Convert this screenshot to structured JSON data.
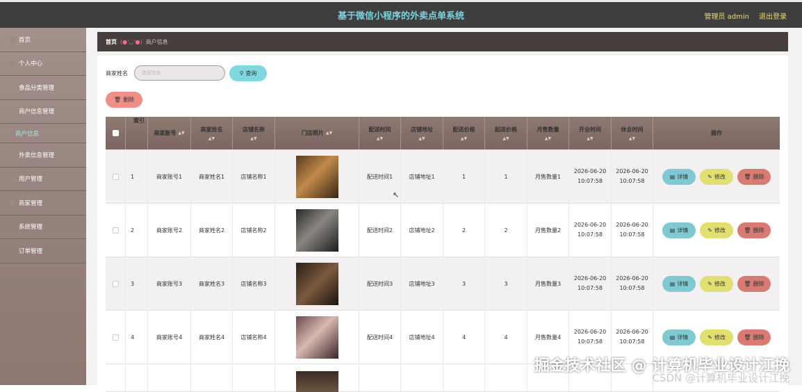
{
  "header": {
    "title": "基于微信小程序的外卖点单系统",
    "admin": "管理员 admin",
    "logout": "退出登录"
  },
  "sidebar": {
    "items": [
      {
        "label": "首页"
      },
      {
        "label": "个人中心"
      },
      {
        "label": "食品分类管理"
      },
      {
        "label": "商户信息管理"
      },
      {
        "label": "商户信息",
        "sub": true
      },
      {
        "label": "外卖信息管理"
      },
      {
        "label": "用户管理"
      },
      {
        "label": "商家管理"
      },
      {
        "label": "系统管理"
      },
      {
        "label": "订单管理"
      }
    ]
  },
  "breadcrumb": {
    "home": "首页",
    "face": "(●'◡'●)",
    "current": "商户信息"
  },
  "search": {
    "label": "商家姓名",
    "placeholder": "商家姓名",
    "button": "查询"
  },
  "toolbar": {
    "delete": "删除"
  },
  "table": {
    "headers": [
      "索引",
      "商家账号",
      "商家姓名",
      "店铺名称",
      "门店照片",
      "配送时间",
      "店铺地址",
      "配送价格",
      "起送价格",
      "月售数量",
      "开业时间",
      "休业时间",
      "操作"
    ],
    "actions": {
      "detail": "详情",
      "edit": "修改",
      "delete": "删除"
    },
    "rows": [
      {
        "index": "1",
        "account": "商家账号1",
        "name": "商家姓名1",
        "shop": "店铺名称1",
        "delivery_time": "配送时间1",
        "address": "店铺地址1",
        "delivery_price": "1",
        "min_price": "1",
        "monthly_sales": "月售数量1",
        "open_date": "2026-06-20",
        "open_time": "10:07:58",
        "close_date": "2026-06-20",
        "close_time": "10:07:58"
      },
      {
        "index": "2",
        "account": "商家账号2",
        "name": "商家姓名2",
        "shop": "店铺名称2",
        "delivery_time": "配送时间2",
        "address": "店铺地址2",
        "delivery_price": "2",
        "min_price": "2",
        "monthly_sales": "月售数量2",
        "open_date": "2026-06-20",
        "open_time": "10:07:58",
        "close_date": "2026-06-20",
        "close_time": "10:07:58"
      },
      {
        "index": "3",
        "account": "商家账号3",
        "name": "商家姓名3",
        "shop": "店铺名称3",
        "delivery_time": "配送时间3",
        "address": "店铺地址3",
        "delivery_price": "3",
        "min_price": "3",
        "monthly_sales": "月售数量3",
        "open_date": "2026-06-20",
        "open_time": "10:07:58",
        "close_date": "2026-06-20",
        "close_time": "10:07:58"
      },
      {
        "index": "4",
        "account": "商家账号4",
        "name": "商家姓名4",
        "shop": "店铺名称4",
        "delivery_time": "配送时间4",
        "address": "店铺地址4",
        "delivery_price": "4",
        "min_price": "4",
        "monthly_sales": "月售数量4",
        "open_date": "2026-06-20",
        "open_time": "10:07:58",
        "close_date": "2026-06-20",
        "close_time": "10:07:58"
      }
    ]
  },
  "watermark": {
    "main": "掘金技术社区 @ 计算机毕业设计江挽",
    "sub": "CSDN @计算机毕业设计江挽"
  },
  "colors": {
    "header_bg": "#3e3e3e",
    "title": "#7fd3dd",
    "sidebar_bg": "#9a8680",
    "table_header_bg": "#86706a",
    "detail_btn": "#7ec9d2",
    "edit_btn": "#e0df70",
    "delete_btn": "#d97a73"
  }
}
